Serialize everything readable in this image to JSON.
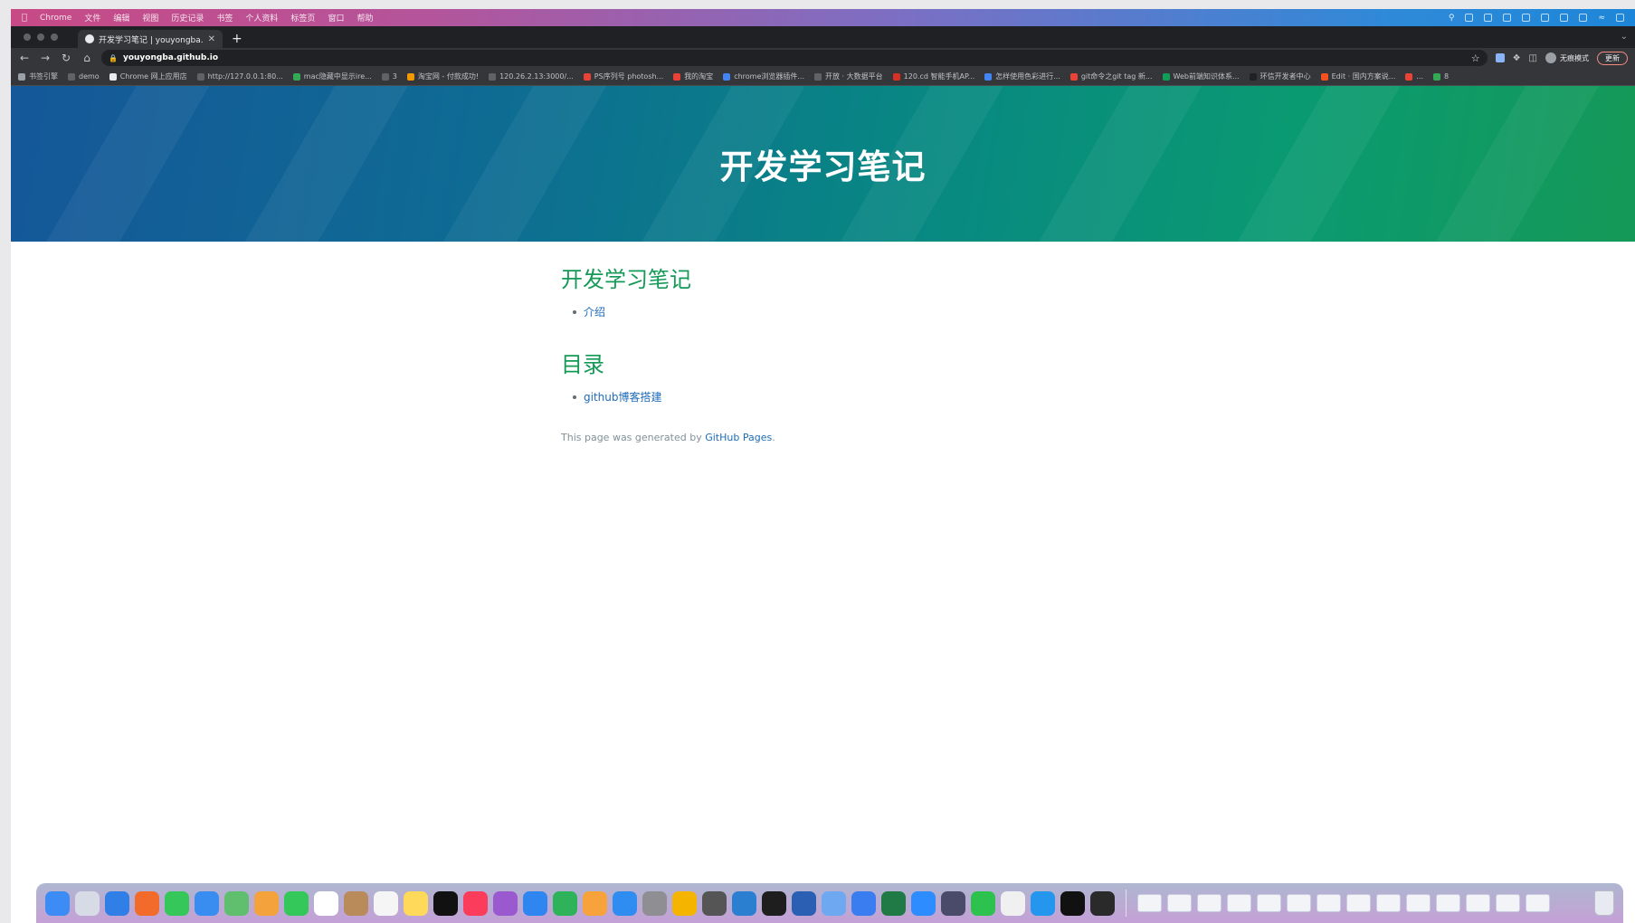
{
  "menubar": {
    "items": [
      "Chrome",
      "文件",
      "编辑",
      "视图",
      "历史记录",
      "书签",
      "个人资料",
      "标签页",
      "窗口",
      "帮助"
    ]
  },
  "browser": {
    "tab_title": "开发学习笔记 | youyongba.gith",
    "url": "youyongba.github.io",
    "profile_label": "无痕模式",
    "update_label": "更新",
    "bookmarks": [
      {
        "label": "书签引擎",
        "color": "#9aa0a6"
      },
      {
        "label": "demo",
        "color": "#5f6368"
      },
      {
        "label": "Chrome 网上应用店",
        "color": "#e8eaed"
      },
      {
        "label": "http://127.0.0.1:80...",
        "color": "#5f6368"
      },
      {
        "label": "mac隐藏中显示ire...",
        "color": "#34a853"
      },
      {
        "label": "3",
        "color": "#5f6368"
      },
      {
        "label": "淘宝网 - 付款成功!",
        "color": "#f29900"
      },
      {
        "label": "120.26.2.13:3000/...",
        "color": "#5f6368"
      },
      {
        "label": "PS序列号 photosh...",
        "color": "#ea4335"
      },
      {
        "label": "我的淘宝",
        "color": "#ea4335"
      },
      {
        "label": "chrome浏览器插件...",
        "color": "#4285f4"
      },
      {
        "label": "开放 · 大数据平台",
        "color": "#5f6368"
      },
      {
        "label": "120.cd 智能手机AP...",
        "color": "#d93025"
      },
      {
        "label": "怎样使用色彩进行...",
        "color": "#4285f4"
      },
      {
        "label": "git命令之git tag 新...",
        "color": "#ea4335"
      },
      {
        "label": "Web前端知识体系...",
        "color": "#0f9d58"
      },
      {
        "label": "环信开发者中心",
        "color": "#202124"
      },
      {
        "label": "Edit · 国内方案说...",
        "color": "#f4511e"
      },
      {
        "label": "...",
        "color": "#ea4335"
      },
      {
        "label": "8",
        "color": "#34a853"
      }
    ]
  },
  "site": {
    "hero_title": "开发学习笔记",
    "section1_heading": "开发学习笔记",
    "section1_links": [
      "介绍"
    ],
    "section2_heading": "目录",
    "section2_links": [
      "github博客搭建"
    ],
    "footer_prefix": "This page was generated by ",
    "footer_link": "GitHub Pages",
    "footer_suffix": "."
  },
  "dock": {
    "apps": [
      {
        "name": "finder",
        "color": "#3d8bf5"
      },
      {
        "name": "launchpad",
        "color": "#d7dbe6"
      },
      {
        "name": "safari",
        "color": "#2f7fe6"
      },
      {
        "name": "firefox",
        "color": "#f26b2a"
      },
      {
        "name": "messages",
        "color": "#35c759"
      },
      {
        "name": "mail",
        "color": "#3a8df0"
      },
      {
        "name": "maps",
        "color": "#5fbf6e"
      },
      {
        "name": "photos",
        "color": "#f3a23c"
      },
      {
        "name": "facetime",
        "color": "#34c759"
      },
      {
        "name": "calendar",
        "color": "#ffffff"
      },
      {
        "name": "contacts",
        "color": "#b98b5a"
      },
      {
        "name": "reminders",
        "color": "#f5f5f5"
      },
      {
        "name": "notes",
        "color": "#ffd95a"
      },
      {
        "name": "tv",
        "color": "#111111"
      },
      {
        "name": "music",
        "color": "#fb3c5b"
      },
      {
        "name": "podcasts",
        "color": "#9b59d0"
      },
      {
        "name": "keynote",
        "color": "#2f86f0"
      },
      {
        "name": "numbers",
        "color": "#2fb35a"
      },
      {
        "name": "pages",
        "color": "#f7a23a"
      },
      {
        "name": "app-store",
        "color": "#2f8cf0"
      },
      {
        "name": "system-preferences",
        "color": "#8e8e93"
      },
      {
        "name": "chrome",
        "color": "#f4b400"
      },
      {
        "name": "calculator",
        "color": "#555555"
      },
      {
        "name": "vscode",
        "color": "#2b7fd1"
      },
      {
        "name": "terminal",
        "color": "#1e1e1e"
      },
      {
        "name": "word",
        "color": "#2b5fb4"
      },
      {
        "name": "network",
        "color": "#6ea8f0"
      },
      {
        "name": "feishu",
        "color": "#3a7df0"
      },
      {
        "name": "excel",
        "color": "#1f7a45"
      },
      {
        "name": "zoom",
        "color": "#2d8cff"
      },
      {
        "name": "preview",
        "color": "#4a4a6a"
      },
      {
        "name": "wechat",
        "color": "#2dc14e"
      },
      {
        "name": "textedit",
        "color": "#f0f0f0"
      },
      {
        "name": "docker",
        "color": "#2496ed"
      },
      {
        "name": "capcut",
        "color": "#111111"
      },
      {
        "name": "obs",
        "color": "#2a2a2a"
      }
    ],
    "windows": 14
  }
}
